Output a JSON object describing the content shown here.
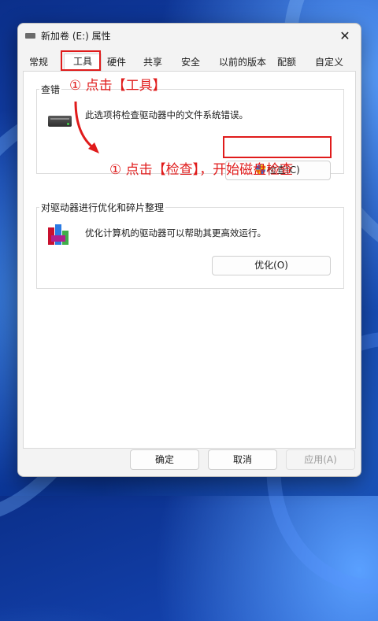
{
  "window": {
    "title": "新加卷 (E:) 属性",
    "close_symbol": "✕"
  },
  "tabs": [
    {
      "label": "常规",
      "active": false
    },
    {
      "label": "工具",
      "active": true
    },
    {
      "label": "硬件",
      "active": false
    },
    {
      "label": "共享",
      "active": false
    },
    {
      "label": "安全",
      "active": false
    },
    {
      "label": "以前的版本",
      "active": false
    },
    {
      "label": "配额",
      "active": false
    },
    {
      "label": "自定义",
      "active": false
    }
  ],
  "error_check": {
    "title": "查错",
    "description": "此选项将检查驱动器中的文件系统错误。",
    "button": "检查(C)"
  },
  "optimize": {
    "title": "对驱动器进行优化和碎片整理",
    "description": "优化计算机的驱动器可以帮助其更高效运行。",
    "button": "优化(O)"
  },
  "footer": {
    "ok": "确定",
    "cancel": "取消",
    "apply": "应用(A)"
  },
  "annotations": {
    "step1": "① 点击【工具】",
    "step2": "① 点击【检查】，开始磁盘检查",
    "color": "#e01b1b"
  }
}
